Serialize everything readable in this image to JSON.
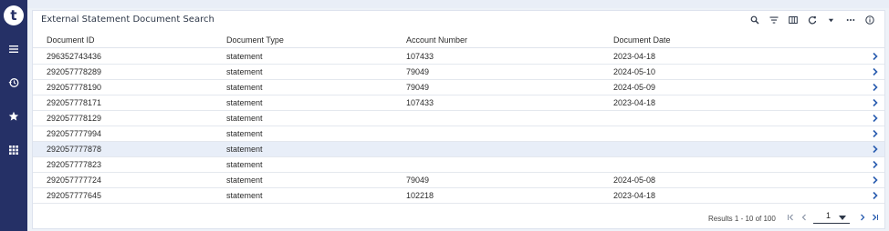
{
  "app": {
    "logo_letter": "t"
  },
  "rail": {
    "items": [
      "menu-icon",
      "history-icon",
      "star-icon",
      "apps-icon"
    ]
  },
  "panel": {
    "title": "External Statement Document Search"
  },
  "toolbar": {
    "icons": [
      "search-icon",
      "filter-icon",
      "columns-icon",
      "refresh-icon",
      "caret-down-icon",
      "more-icon",
      "info-icon"
    ]
  },
  "table": {
    "columns": [
      "Document ID",
      "Document Type",
      "Account Number",
      "Document Date"
    ],
    "rows": [
      {
        "id": "296352743436",
        "type": "statement",
        "account": "107433",
        "date": "2023-04-18"
      },
      {
        "id": "292057778289",
        "type": "statement",
        "account": "79049",
        "date": "2024-05-10"
      },
      {
        "id": "292057778190",
        "type": "statement",
        "account": "79049",
        "date": "2024-05-09"
      },
      {
        "id": "292057778171",
        "type": "statement",
        "account": "107433",
        "date": "2023-04-18"
      },
      {
        "id": "292057778129",
        "type": "statement",
        "account": "",
        "date": ""
      },
      {
        "id": "292057777994",
        "type": "statement",
        "account": "",
        "date": ""
      },
      {
        "id": "292057777878",
        "type": "statement",
        "account": "",
        "date": ""
      },
      {
        "id": "292057777823",
        "type": "statement",
        "account": "",
        "date": ""
      },
      {
        "id": "292057777724",
        "type": "statement",
        "account": "79049",
        "date": "2024-05-08"
      },
      {
        "id": "292057777645",
        "type": "statement",
        "account": "102218",
        "date": "2023-04-18"
      }
    ],
    "selected_row_index": 6
  },
  "footer": {
    "results": "Results 1 - 10 of 100",
    "page": "1"
  },
  "colors": {
    "rail": "#253066",
    "accent": "#2a5db0",
    "selected_row": "#e8eef8"
  }
}
